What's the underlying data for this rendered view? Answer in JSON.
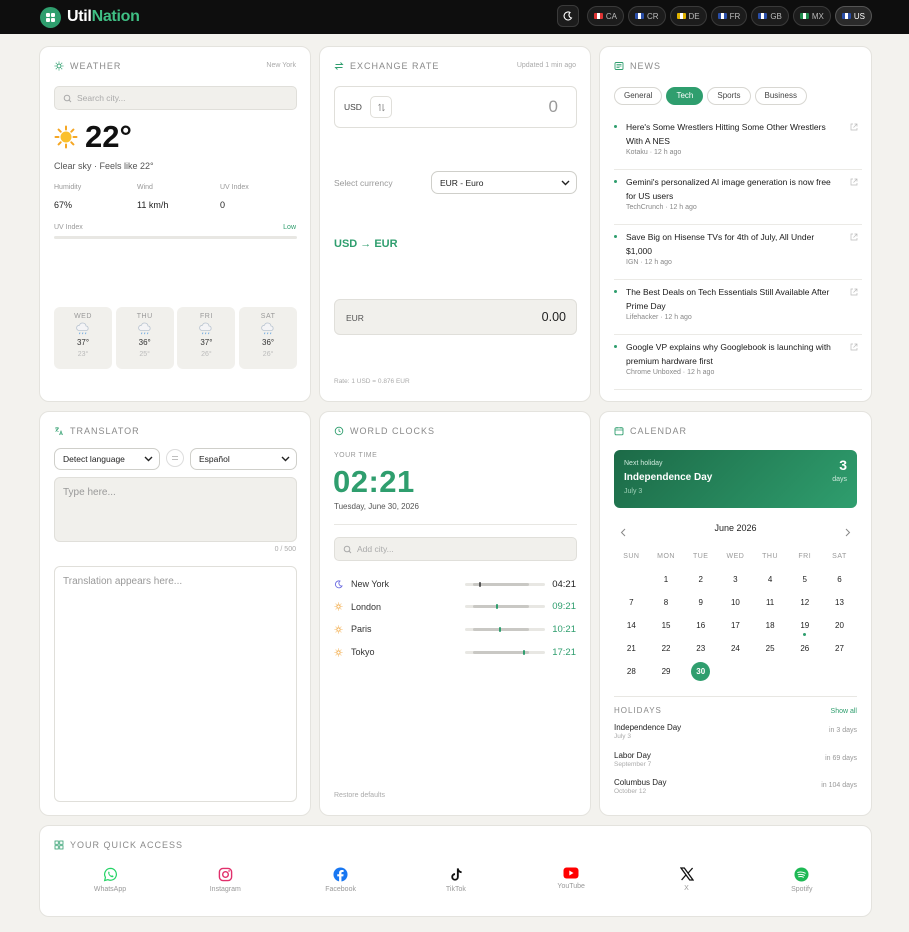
{
  "app": {
    "name_a": "Util",
    "name_b": "Nation"
  },
  "countries": [
    {
      "code": "CA",
      "color": "#d33"
    },
    {
      "code": "CR",
      "color": "#2a4ea8"
    },
    {
      "code": "DE",
      "color": "#e0b300"
    },
    {
      "code": "FR",
      "color": "#2a4ea8"
    },
    {
      "code": "GB",
      "color": "#2a4ea8"
    },
    {
      "code": "MX",
      "color": "#1f8a4c"
    },
    {
      "code": "US",
      "color": "#2a4ea8"
    }
  ],
  "active_country": "US",
  "weather": {
    "title": "WEATHER",
    "location": "New York",
    "search_placeholder": "Search city...",
    "temp": "22°",
    "desc": "Clear sky · Feels like 22°",
    "stats": [
      {
        "label": "Humidity",
        "value": "67%"
      },
      {
        "label": "Wind",
        "value": "11 km/h"
      },
      {
        "label": "UV Index",
        "value": "0"
      }
    ],
    "uv_label": "UV Index",
    "uv_level": "Low",
    "uv_fraction": 0.0,
    "forecast": [
      {
        "day": "WED",
        "hi": "37°",
        "lo": "23°"
      },
      {
        "day": "THU",
        "hi": "36°",
        "lo": "25°"
      },
      {
        "day": "FRI",
        "hi": "37°",
        "lo": "26°"
      },
      {
        "day": "SAT",
        "hi": "36°",
        "lo": "26°"
      }
    ]
  },
  "exchange": {
    "title": "EXCHANGE RATE",
    "updated": "Updated 1 min ago",
    "from_code": "USD",
    "amount": "0",
    "select_label": "Select currency",
    "selected": "EUR - Euro",
    "pair": "USD → EUR",
    "to_code": "EUR",
    "result": "0.00",
    "rate": "Rate: 1 USD = 0.876 EUR"
  },
  "news": {
    "title": "NEWS",
    "tabs": [
      "General",
      "Tech",
      "Sports",
      "Business"
    ],
    "active_tab": "Tech",
    "items": [
      {
        "title": "Here's Some Wrestlers Hitting Some Other Wrestlers With A NES",
        "meta": "Kotaku · 12 h ago"
      },
      {
        "title": "Gemini's personalized AI image generation is now free for US users",
        "meta": "TechCrunch · 12 h ago"
      },
      {
        "title": "Save Big on Hisense TVs for 4th of July, All Under $1,000",
        "meta": "IGN · 12 h ago"
      },
      {
        "title": "The Best Deals on Tech Essentials Still Available After Prime Day",
        "meta": "Lifehacker · 12 h ago"
      },
      {
        "title": "Google VP explains why Googlebook is launching with premium hardware first",
        "meta": "Chrome Unboxed · 12 h ago"
      }
    ]
  },
  "translator": {
    "title": "TRANSLATOR",
    "source_lang": "Detect language",
    "target_lang": "Español",
    "input_placeholder": "Type here...",
    "counter": "0 / 500",
    "output_placeholder": "Translation appears here..."
  },
  "clocks": {
    "title": "WORLD CLOCKS",
    "your_time_label": "YOUR TIME",
    "time": "02:21",
    "date": "Tuesday, June 30, 2026",
    "search_placeholder": "Add city...",
    "cities": [
      {
        "name": "New York",
        "time": "04:21",
        "icon": "moon-icon",
        "day_fraction": 0.18,
        "highlight": false
      },
      {
        "name": "London",
        "time": "09:21",
        "icon": "sun-icon",
        "day_fraction": 0.39,
        "highlight": true
      },
      {
        "name": "Paris",
        "time": "10:21",
        "icon": "sun-icon",
        "day_fraction": 0.43,
        "highlight": true
      },
      {
        "name": "Tokyo",
        "time": "17:21",
        "icon": "sun-icon",
        "day_fraction": 0.72,
        "highlight": true
      }
    ],
    "restore": "Restore defaults"
  },
  "calendar": {
    "title": "CALENDAR",
    "next_label": "Next holiday",
    "next_name": "Independence Day",
    "next_date": "July 3",
    "next_days": "3",
    "next_days_unit": "days",
    "month": "June 2026",
    "weekdays": [
      "SUN",
      "MON",
      "TUE",
      "WED",
      "THU",
      "FRI",
      "SAT"
    ],
    "weeks": [
      [
        "",
        "1",
        "2",
        "3",
        "4",
        "5",
        "6"
      ],
      [
        "7",
        "8",
        "9",
        "10",
        "11",
        "12",
        "13"
      ],
      [
        "14",
        "15",
        "16",
        "17",
        "18",
        "19",
        "20"
      ],
      [
        "21",
        "22",
        "23",
        "24",
        "25",
        "26",
        "27"
      ],
      [
        "28",
        "29",
        "30",
        "",
        "",
        "",
        ""
      ]
    ],
    "today": "30",
    "marked": "19",
    "holidays_label": "HOLIDAYS",
    "show_all": "Show all",
    "holidays": [
      {
        "name": "Independence Day",
        "date": "July 3",
        "in": "in 3 days"
      },
      {
        "name": "Labor Day",
        "date": "September 7",
        "in": "in 69 days"
      },
      {
        "name": "Columbus Day",
        "date": "October 12",
        "in": "in 104 days"
      }
    ]
  },
  "quick_access": {
    "title": "YOUR QUICK ACCESS",
    "items": [
      {
        "name": "WhatsApp",
        "color": "#25d366"
      },
      {
        "name": "Instagram",
        "color": "#e1306c"
      },
      {
        "name": "Facebook",
        "color": "#1877f2"
      },
      {
        "name": "TikTok",
        "color": "#111111"
      },
      {
        "name": "YouTube",
        "color": "#ff0000"
      },
      {
        "name": "X",
        "color": "#111111"
      },
      {
        "name": "Spotify",
        "color": "#1db954"
      }
    ]
  },
  "colors": {
    "accent": "#2f9e6e",
    "background": "#f3f2ee",
    "topbar": "#0e0e0e"
  }
}
